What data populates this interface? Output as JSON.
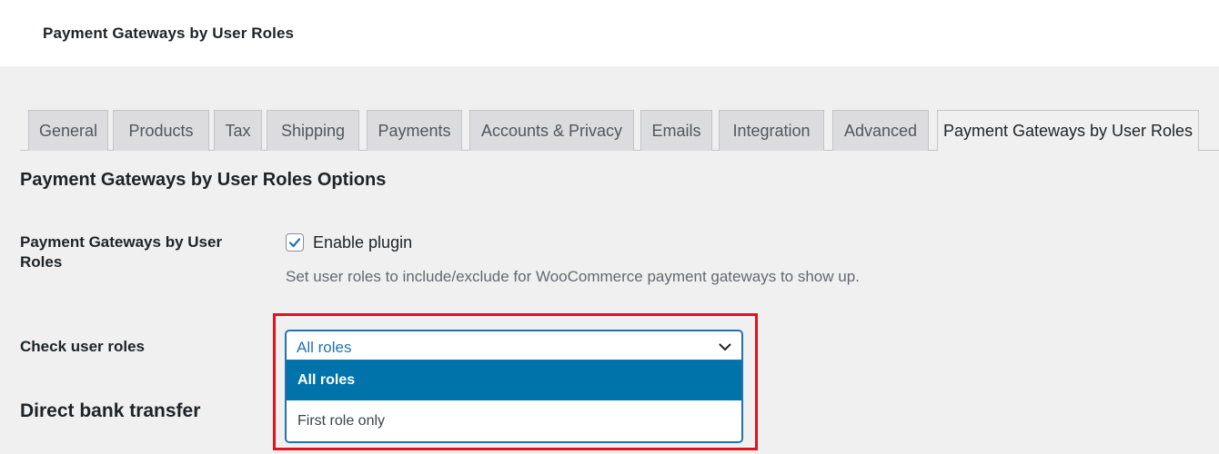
{
  "header": {
    "title": "Payment Gateways by User Roles"
  },
  "tabs": [
    {
      "label": "General"
    },
    {
      "label": "Products"
    },
    {
      "label": "Tax"
    },
    {
      "label": "Shipping"
    },
    {
      "label": "Payments"
    },
    {
      "label": "Accounts & Privacy"
    },
    {
      "label": "Emails"
    },
    {
      "label": "Integration"
    },
    {
      "label": "Advanced"
    },
    {
      "label": "Payment Gateways by User Roles",
      "active": true
    }
  ],
  "section": {
    "title": "Payment Gateways by User Roles Options"
  },
  "enable_row": {
    "label": "Payment Gateways by User Roles",
    "checkbox_label": "Enable plugin",
    "checked": true,
    "description": "Set user roles to include/exclude for WooCommerce payment gateways to show up."
  },
  "check_roles_row": {
    "label": "Check user roles",
    "selected_value": "All roles",
    "options": [
      "All roles",
      "First role only"
    ]
  },
  "next_section": {
    "title": "Direct bank transfer"
  },
  "colors": {
    "accent": "#2271b1",
    "selected_option_bg": "#0073aa",
    "highlight_border": "#e5101b"
  },
  "icons": {
    "checkbox_check": "checkmark-icon",
    "select_arrow": "chevron-down-icon"
  }
}
